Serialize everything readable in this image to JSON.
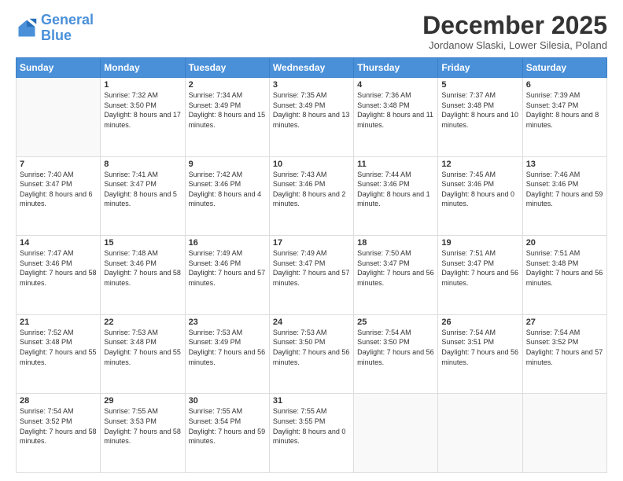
{
  "header": {
    "logo_line1": "General",
    "logo_line2": "Blue",
    "month": "December 2025",
    "location": "Jordanow Slaski, Lower Silesia, Poland"
  },
  "days_of_week": [
    "Sunday",
    "Monday",
    "Tuesday",
    "Wednesday",
    "Thursday",
    "Friday",
    "Saturday"
  ],
  "weeks": [
    [
      {
        "day": "",
        "sunrise": "",
        "sunset": "",
        "daylight": ""
      },
      {
        "day": "1",
        "sunrise": "Sunrise: 7:32 AM",
        "sunset": "Sunset: 3:50 PM",
        "daylight": "Daylight: 8 hours and 17 minutes."
      },
      {
        "day": "2",
        "sunrise": "Sunrise: 7:34 AM",
        "sunset": "Sunset: 3:49 PM",
        "daylight": "Daylight: 8 hours and 15 minutes."
      },
      {
        "day": "3",
        "sunrise": "Sunrise: 7:35 AM",
        "sunset": "Sunset: 3:49 PM",
        "daylight": "Daylight: 8 hours and 13 minutes."
      },
      {
        "day": "4",
        "sunrise": "Sunrise: 7:36 AM",
        "sunset": "Sunset: 3:48 PM",
        "daylight": "Daylight: 8 hours and 11 minutes."
      },
      {
        "day": "5",
        "sunrise": "Sunrise: 7:37 AM",
        "sunset": "Sunset: 3:48 PM",
        "daylight": "Daylight: 8 hours and 10 minutes."
      },
      {
        "day": "6",
        "sunrise": "Sunrise: 7:39 AM",
        "sunset": "Sunset: 3:47 PM",
        "daylight": "Daylight: 8 hours and 8 minutes."
      }
    ],
    [
      {
        "day": "7",
        "sunrise": "Sunrise: 7:40 AM",
        "sunset": "Sunset: 3:47 PM",
        "daylight": "Daylight: 8 hours and 6 minutes."
      },
      {
        "day": "8",
        "sunrise": "Sunrise: 7:41 AM",
        "sunset": "Sunset: 3:47 PM",
        "daylight": "Daylight: 8 hours and 5 minutes."
      },
      {
        "day": "9",
        "sunrise": "Sunrise: 7:42 AM",
        "sunset": "Sunset: 3:46 PM",
        "daylight": "Daylight: 8 hours and 4 minutes."
      },
      {
        "day": "10",
        "sunrise": "Sunrise: 7:43 AM",
        "sunset": "Sunset: 3:46 PM",
        "daylight": "Daylight: 8 hours and 2 minutes."
      },
      {
        "day": "11",
        "sunrise": "Sunrise: 7:44 AM",
        "sunset": "Sunset: 3:46 PM",
        "daylight": "Daylight: 8 hours and 1 minute."
      },
      {
        "day": "12",
        "sunrise": "Sunrise: 7:45 AM",
        "sunset": "Sunset: 3:46 PM",
        "daylight": "Daylight: 8 hours and 0 minutes."
      },
      {
        "day": "13",
        "sunrise": "Sunrise: 7:46 AM",
        "sunset": "Sunset: 3:46 PM",
        "daylight": "Daylight: 7 hours and 59 minutes."
      }
    ],
    [
      {
        "day": "14",
        "sunrise": "Sunrise: 7:47 AM",
        "sunset": "Sunset: 3:46 PM",
        "daylight": "Daylight: 7 hours and 58 minutes."
      },
      {
        "day": "15",
        "sunrise": "Sunrise: 7:48 AM",
        "sunset": "Sunset: 3:46 PM",
        "daylight": "Daylight: 7 hours and 58 minutes."
      },
      {
        "day": "16",
        "sunrise": "Sunrise: 7:49 AM",
        "sunset": "Sunset: 3:46 PM",
        "daylight": "Daylight: 7 hours and 57 minutes."
      },
      {
        "day": "17",
        "sunrise": "Sunrise: 7:49 AM",
        "sunset": "Sunset: 3:47 PM",
        "daylight": "Daylight: 7 hours and 57 minutes."
      },
      {
        "day": "18",
        "sunrise": "Sunrise: 7:50 AM",
        "sunset": "Sunset: 3:47 PM",
        "daylight": "Daylight: 7 hours and 56 minutes."
      },
      {
        "day": "19",
        "sunrise": "Sunrise: 7:51 AM",
        "sunset": "Sunset: 3:47 PM",
        "daylight": "Daylight: 7 hours and 56 minutes."
      },
      {
        "day": "20",
        "sunrise": "Sunrise: 7:51 AM",
        "sunset": "Sunset: 3:48 PM",
        "daylight": "Daylight: 7 hours and 56 minutes."
      }
    ],
    [
      {
        "day": "21",
        "sunrise": "Sunrise: 7:52 AM",
        "sunset": "Sunset: 3:48 PM",
        "daylight": "Daylight: 7 hours and 55 minutes."
      },
      {
        "day": "22",
        "sunrise": "Sunrise: 7:53 AM",
        "sunset": "Sunset: 3:48 PM",
        "daylight": "Daylight: 7 hours and 55 minutes."
      },
      {
        "day": "23",
        "sunrise": "Sunrise: 7:53 AM",
        "sunset": "Sunset: 3:49 PM",
        "daylight": "Daylight: 7 hours and 56 minutes."
      },
      {
        "day": "24",
        "sunrise": "Sunrise: 7:53 AM",
        "sunset": "Sunset: 3:50 PM",
        "daylight": "Daylight: 7 hours and 56 minutes."
      },
      {
        "day": "25",
        "sunrise": "Sunrise: 7:54 AM",
        "sunset": "Sunset: 3:50 PM",
        "daylight": "Daylight: 7 hours and 56 minutes."
      },
      {
        "day": "26",
        "sunrise": "Sunrise: 7:54 AM",
        "sunset": "Sunset: 3:51 PM",
        "daylight": "Daylight: 7 hours and 56 minutes."
      },
      {
        "day": "27",
        "sunrise": "Sunrise: 7:54 AM",
        "sunset": "Sunset: 3:52 PM",
        "daylight": "Daylight: 7 hours and 57 minutes."
      }
    ],
    [
      {
        "day": "28",
        "sunrise": "Sunrise: 7:54 AM",
        "sunset": "Sunset: 3:52 PM",
        "daylight": "Daylight: 7 hours and 58 minutes."
      },
      {
        "day": "29",
        "sunrise": "Sunrise: 7:55 AM",
        "sunset": "Sunset: 3:53 PM",
        "daylight": "Daylight: 7 hours and 58 minutes."
      },
      {
        "day": "30",
        "sunrise": "Sunrise: 7:55 AM",
        "sunset": "Sunset: 3:54 PM",
        "daylight": "Daylight: 7 hours and 59 minutes."
      },
      {
        "day": "31",
        "sunrise": "Sunrise: 7:55 AM",
        "sunset": "Sunset: 3:55 PM",
        "daylight": "Daylight: 8 hours and 0 minutes."
      },
      {
        "day": "",
        "sunrise": "",
        "sunset": "",
        "daylight": ""
      },
      {
        "day": "",
        "sunrise": "",
        "sunset": "",
        "daylight": ""
      },
      {
        "day": "",
        "sunrise": "",
        "sunset": "",
        "daylight": ""
      }
    ]
  ]
}
